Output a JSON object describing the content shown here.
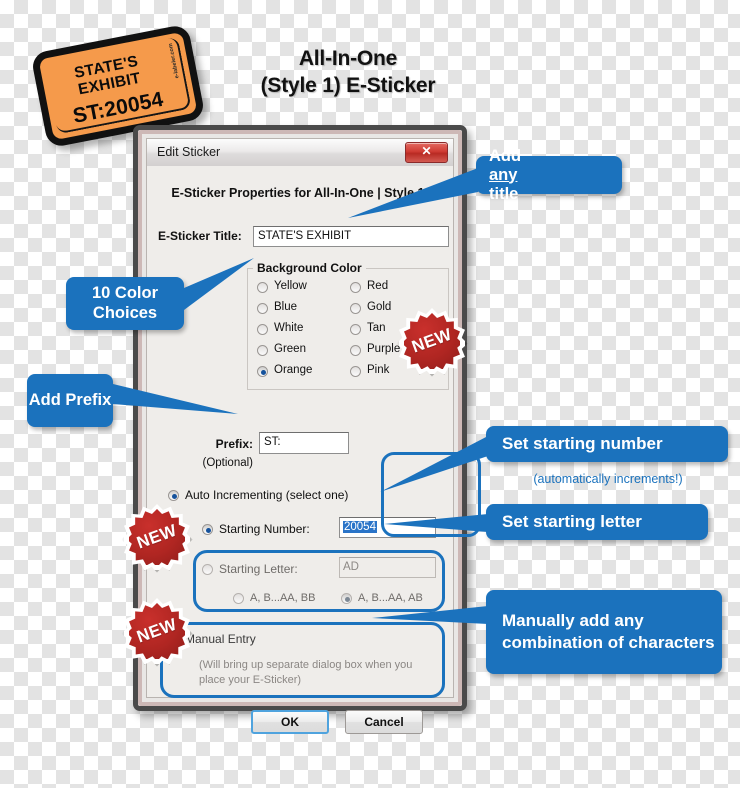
{
  "heading": {
    "line1": "All-In-One",
    "line2": "(Style 1) E-Sticker"
  },
  "ticket": {
    "line1": "STATE'S",
    "line2": "EXHIBIT",
    "line3": "ST:20054",
    "side_text": "e-labeler.com"
  },
  "dialog": {
    "titlebar": {
      "title": "Edit Sticker",
      "close_label": "✕"
    },
    "properties_title": "E-Sticker Properties for All-In-One | Style 1:",
    "title_field": {
      "label": "E-Sticker Title:",
      "value": "STATE'S EXHIBIT"
    },
    "background_color": {
      "legend": "Background Color",
      "left_options": [
        {
          "label": "Yellow",
          "selected": false
        },
        {
          "label": "Blue",
          "selected": false
        },
        {
          "label": "White",
          "selected": false
        },
        {
          "label": "Green",
          "selected": false
        },
        {
          "label": "Orange",
          "selected": true
        }
      ],
      "right_options": [
        {
          "label": "Red",
          "selected": false
        },
        {
          "label": "Gold",
          "selected": false
        },
        {
          "label": "Tan",
          "selected": false
        },
        {
          "label": "Purple",
          "selected": false
        },
        {
          "label": "Pink",
          "selected": false
        }
      ]
    },
    "prefix": {
      "label": "Prefix:",
      "sublabel": "(Optional)",
      "value": "ST:"
    },
    "auto_increment": {
      "label": "Auto Incrementing (select one)",
      "selected": true
    },
    "starting_number": {
      "label": "Starting Number:",
      "value": "20054",
      "selected": true
    },
    "starting_letter": {
      "label": "Starting Letter:",
      "value": "AD",
      "selected": false
    },
    "letter_scheme": {
      "option_a": "A, B...AA, BB",
      "option_b": "A, B...AA, AB",
      "selected": "option_b"
    },
    "manual_entry": {
      "label": "Manual Entry",
      "hint": "(Will bring up separate dialog box when you place your E-Sticker)",
      "selected": false
    },
    "buttons": {
      "ok": "OK",
      "cancel": "Cancel"
    }
  },
  "callouts": {
    "title": {
      "pre": "Add ",
      "emph": "any",
      "post": " title"
    },
    "colors": "10 Color Choices",
    "prefix": "Add Prefix",
    "starting_number": "Set starting number",
    "auto_note": "(automatically increments!)",
    "starting_letter": "Set starting letter",
    "manual": "Manually add any combination of characters"
  },
  "badges": {
    "new": "NEW"
  },
  "colors": {
    "accent_blue": "#1b72bd",
    "badge_red": "#b02622",
    "ticket_orange": "#F59A4B",
    "selection_blue": "#2a74c8"
  }
}
